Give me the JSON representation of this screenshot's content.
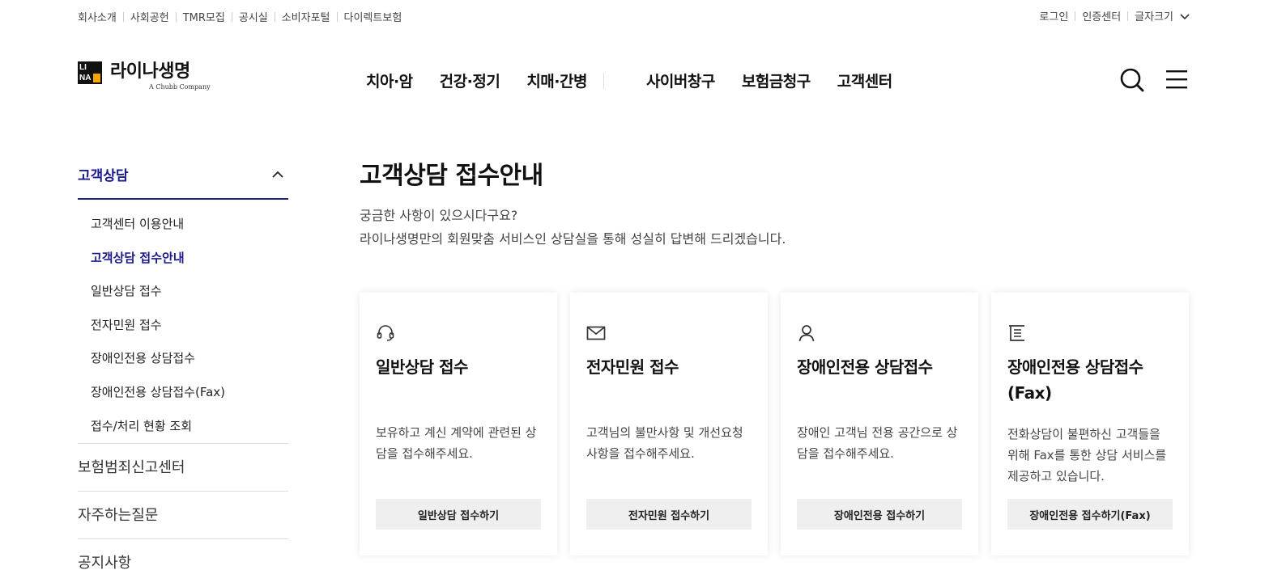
{
  "utility": {
    "left_links": [
      "회사소개",
      "사회공헌",
      "TMR모집",
      "공시실",
      "소비자포털",
      "다이렉트보험"
    ],
    "right_links": [
      "로그인",
      "인증센터",
      "글자크기"
    ]
  },
  "logo": {
    "box_text": [
      "LI",
      "NA"
    ],
    "name": "라이나생명",
    "sub": "A Chubb Company"
  },
  "gnb": {
    "left": [
      "치아·암",
      "건강·정기",
      "치매·간병"
    ],
    "right": [
      "사이버창구",
      "보험금청구",
      "고객센터"
    ]
  },
  "lnb": {
    "head": "고객상담",
    "sub_items": [
      "고객센터 이용안내",
      "고객상담 접수안내",
      "일반상담 접수",
      "전자민원 접수",
      "장애인전용 상담접수",
      "장애인전용 상담접수(Fax)",
      "접수/처리 현황 조회"
    ],
    "active_index": 1,
    "items": [
      "보험범죄신고센터",
      "자주하는질문",
      "공지사항"
    ]
  },
  "main": {
    "title": "고객상담 접수안내",
    "intro_line1": "궁금한 사항이 있으시다구요?",
    "intro_line2": "라이나생명만의 회원맞춤 서비스인 상담실을 통해 성실히 답변해 드리겠습니다."
  },
  "cards": [
    {
      "icon": "headset-icon",
      "title": "일반상담 접수",
      "desc": "보유하고 계신 계약에 관련된 상담을 접수해주세요.",
      "button": "일반상담 접수하기"
    },
    {
      "icon": "mail-icon",
      "title": "전자민원 접수",
      "desc": "고객님의 불만사항 및 개선요청 사항을 접수해주세요.",
      "button": "전자민원 접수하기"
    },
    {
      "icon": "person-icon",
      "title": "장애인전용 상담접수",
      "desc": "장애인 고객님 전용 공간으로 상담을 접수해주세요.",
      "button": "장애인전용 접수하기"
    },
    {
      "icon": "document-icon",
      "title": "장애인전용 상담접수 (Fax)",
      "desc": "전화상담이 불편하신 고객들을 위해 Fax를 통한 상담 서비스를 제공하고 있습니다.",
      "button": "장애인전용 접수하기(Fax)"
    }
  ],
  "colors": {
    "accent": "#1a1a8c",
    "logo_yellow": "#f5a800"
  }
}
